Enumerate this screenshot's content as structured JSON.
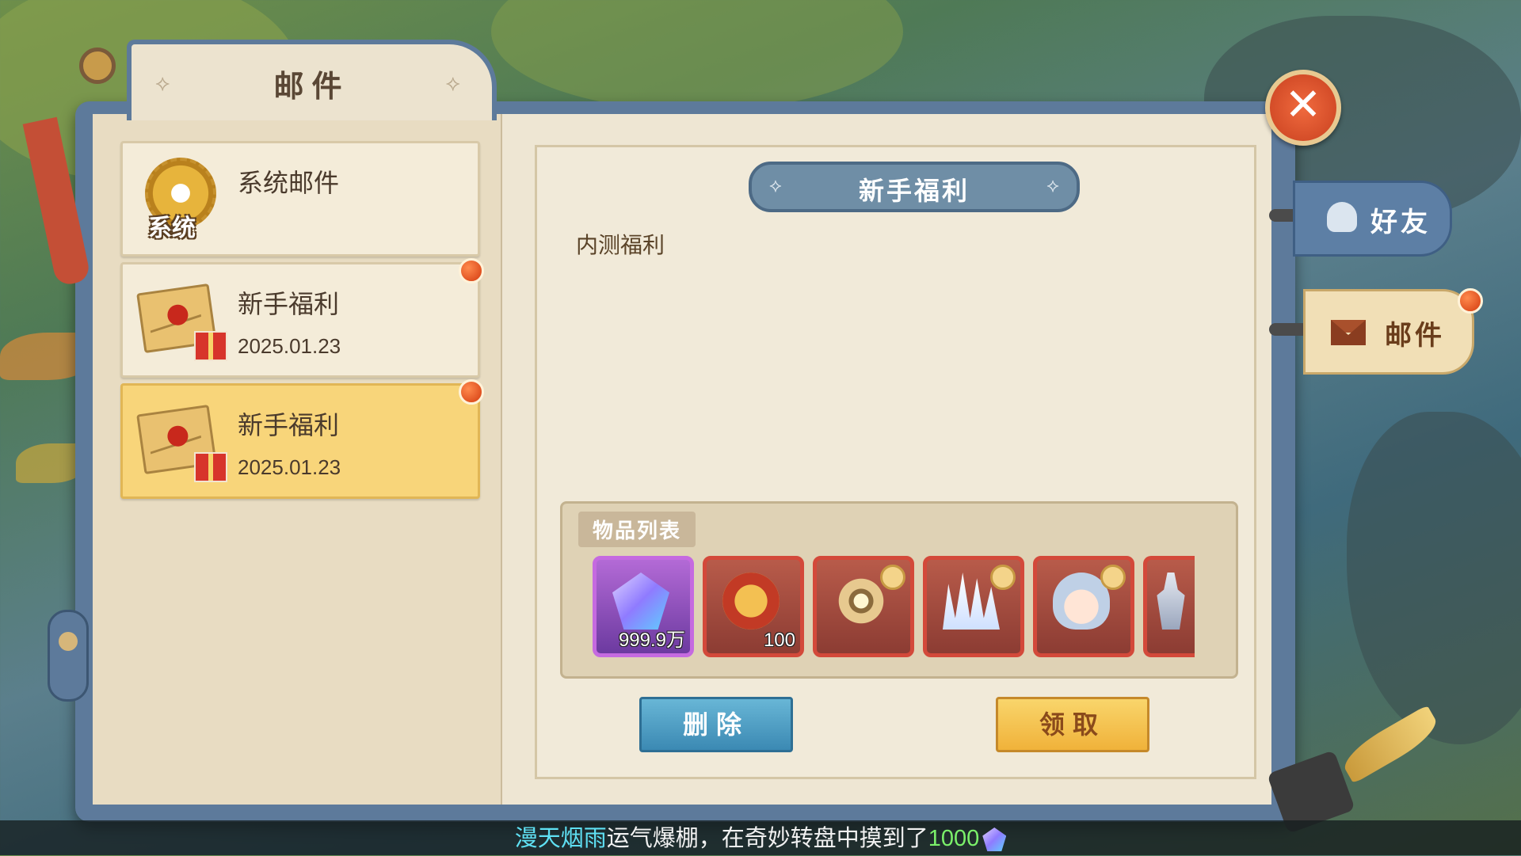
{
  "window": {
    "title": "邮件",
    "close_symbol": "✕"
  },
  "mail_list": [
    {
      "title": "系统邮件",
      "icon": "gear-icon",
      "icon_label": "系统",
      "date": "",
      "unread": false,
      "selected": false
    },
    {
      "title": "新手福利",
      "icon": "envelope-gift-icon",
      "date": "2025.01.23",
      "unread": true,
      "selected": false
    },
    {
      "title": "新手福利",
      "icon": "envelope-gift-icon",
      "date": "2025.01.23",
      "unread": true,
      "selected": true
    }
  ],
  "mail_detail": {
    "title": "新手福利",
    "body": "内测福利",
    "items_label": "物品列表",
    "items": [
      {
        "icon": "diamond-gem-icon",
        "count": "999.9万",
        "rarity": "purple"
      },
      {
        "icon": "red-coin-icon",
        "count": "100",
        "rarity": "red"
      },
      {
        "icon": "compass-emblem-icon",
        "count": "",
        "rarity": "red",
        "preview": true
      },
      {
        "icon": "ice-spikes-icon",
        "count": "",
        "rarity": "red",
        "preview": true
      },
      {
        "icon": "character-portrait-icon",
        "count": "",
        "rarity": "red",
        "preview": true
      },
      {
        "icon": "character-figure-icon",
        "count": "",
        "rarity": "red"
      }
    ],
    "delete_label": "删除",
    "claim_label": "领取"
  },
  "side_tabs": {
    "friends_label": "好友",
    "mail_label": "邮件",
    "mail_badge": true
  },
  "ticker": {
    "player": "漫天烟雨",
    "message": "运气爆棚，在奇妙转盘中摸到了",
    "amount": "1000",
    "reward_icon": "diamond-gem-icon"
  },
  "colors": {
    "frame_blue": "#5d7a9b",
    "selected_item": "#f8d57a",
    "delete_button": "#3b89b3",
    "claim_button": "#f0b23a",
    "ticker_name": "#5fe0f3",
    "ticker_amount": "#7bf06a"
  }
}
